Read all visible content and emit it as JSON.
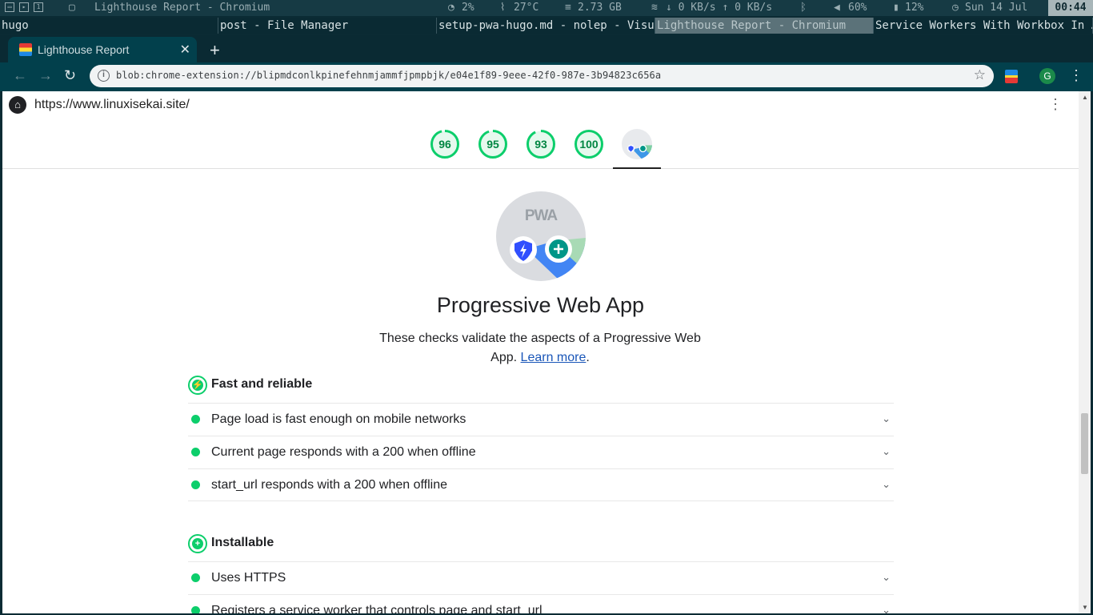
{
  "system_bar": {
    "window_title": "Lighthouse Report - Chromium",
    "cpu": "2%",
    "temp": "27°C",
    "memory": "2.73 GB",
    "network": "↓ 0 KB/s ↑ 0 KB/s",
    "volume": "60%",
    "battery": "12%",
    "date": "Sun 14 Jul",
    "time": "00:44"
  },
  "window_list": [
    "hugo",
    "post - File Manager",
    "setup-pwa-hugo.md - nolep - Visu…",
    "Lighthouse Report - Chromium",
    "Service Workers With Workbox In …"
  ],
  "browser": {
    "tab_title": "Lighthouse Report",
    "address": "blob:chrome-extension://blipmdconlkpinefehnmjammfjpmpbjk/e04e1f89-9eee-42f0-987e-3b94823c656a",
    "avatar_letter": "G"
  },
  "report": {
    "site_url": "https://www.linuxisekai.site/",
    "gauges": [
      {
        "value": "96",
        "score": 0.96
      },
      {
        "value": "95",
        "score": 0.95
      },
      {
        "value": "93",
        "score": 0.93
      },
      {
        "value": "100",
        "score": 1.0
      }
    ],
    "pwa_badge_text": "PWA",
    "category_title": "Progressive Web App",
    "description": "These checks validate the aspects of a Progressive Web App.",
    "learn_more": "Learn more",
    "groups": [
      {
        "title": "Fast and reliable",
        "audits": [
          "Page load is fast enough on mobile networks",
          "Current page responds with a 200 when offline",
          "start_url responds with a 200 when offline"
        ]
      },
      {
        "title": "Installable",
        "audits": [
          "Uses HTTPS",
          "Registers a service worker that controls page and start_url"
        ]
      }
    ]
  },
  "colors": {
    "pass_green": "#0cce6b",
    "pass_text": "#018642",
    "chrome_toolbar": "#02404c"
  }
}
